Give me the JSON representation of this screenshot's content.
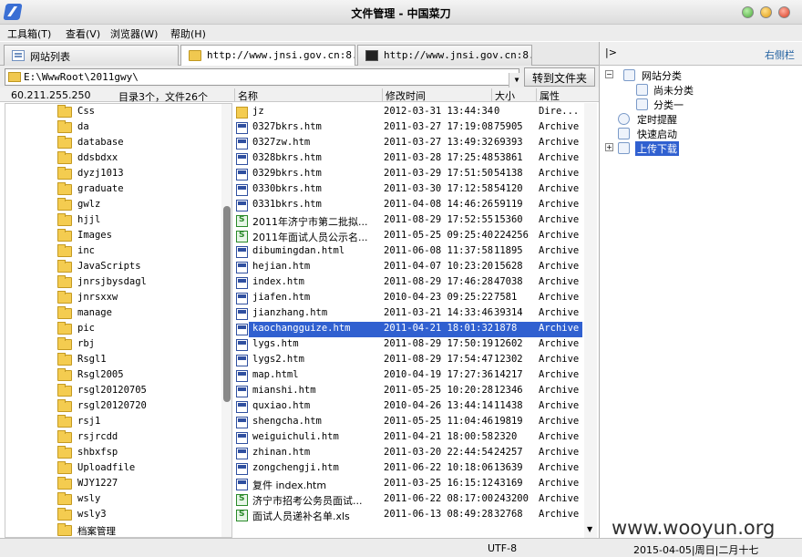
{
  "window": {
    "title": "文件管理 - 中国菜刀"
  },
  "menu": [
    "工具箱(T)",
    "查看(V)",
    "浏览器(W)",
    "帮助(H)"
  ],
  "tabs": [
    {
      "label": "网站列表",
      "icon": "page-icon"
    },
    {
      "label": "http://www.jnsi.gov.cn:8...",
      "icon": "folder-icon"
    },
    {
      "label": "http://www.jnsi.gov.cn:8...",
      "icon": "terminal-icon"
    }
  ],
  "sidebar": {
    "toggle": "|>",
    "title": "右侧栏",
    "items": [
      {
        "label": "网站分类",
        "expander": "−"
      },
      {
        "label": "尚未分类"
      },
      {
        "label": "分类一"
      },
      {
        "label": "定时提醒"
      },
      {
        "label": "快速启动"
      },
      {
        "label": "上传下载",
        "expander": "+"
      }
    ]
  },
  "path": {
    "value": "E:\\WwwRoot\\2011gwy\\",
    "goto_label": "转到文件夹"
  },
  "info": {
    "ip": "60.211.255.250",
    "count": "目录3个，文件26个"
  },
  "columns": {
    "name": "名称",
    "time": "修改时间",
    "size": "大小",
    "attr": "属性"
  },
  "tree": [
    "Css",
    "da",
    "database",
    "ddsbdxx",
    "dyzj1013",
    "graduate",
    "gwlz",
    "hjjl",
    "Images",
    "inc",
    "JavaScripts",
    "jnrsjbysdagl",
    "jnrsxxw",
    "manage",
    "pic",
    "rbj",
    "Rsgl1",
    "Rsgl2005",
    "rsgl20120705",
    "rsgl20120720",
    "rsj1",
    "rsjrcdd",
    "shbxfsp",
    "Uploadfile",
    "WJY1227",
    "wsly",
    "wsly3",
    "档案管理"
  ],
  "files": [
    {
      "name": "jz",
      "time": "2012-03-31 13:44:34",
      "size": "0",
      "attr": "Dire...",
      "type": "dir"
    },
    {
      "name": "0327bkrs.htm",
      "time": "2011-03-27 17:19:08",
      "size": "75905",
      "attr": "Archive",
      "type": "htm"
    },
    {
      "name": "0327zw.htm",
      "time": "2011-03-27 13:49:32",
      "size": "69393",
      "attr": "Archive",
      "type": "htm"
    },
    {
      "name": "0328bkrs.htm",
      "time": "2011-03-28 17:25:48",
      "size": "53861",
      "attr": "Archive",
      "type": "htm"
    },
    {
      "name": "0329bkrs.htm",
      "time": "2011-03-29 17:51:50",
      "size": "54138",
      "attr": "Archive",
      "type": "htm"
    },
    {
      "name": "0330bkrs.htm",
      "time": "2011-03-30 17:12:58",
      "size": "54120",
      "attr": "Archive",
      "type": "htm"
    },
    {
      "name": "0331bkrs.htm",
      "time": "2011-04-08 14:46:26",
      "size": "59119",
      "attr": "Archive",
      "type": "htm"
    },
    {
      "name": "2011年济宁市第二批拟...",
      "time": "2011-08-29 17:52:55",
      "size": "15360",
      "attr": "Archive",
      "type": "xls"
    },
    {
      "name": "2011年面试人员公示名...",
      "time": "2011-05-25 09:25:40",
      "size": "224256",
      "attr": "Archive",
      "type": "xls"
    },
    {
      "name": "dibumingdan.html",
      "time": "2011-06-08 11:37:58",
      "size": "11895",
      "attr": "Archive",
      "type": "htm"
    },
    {
      "name": "hejian.htm",
      "time": "2011-04-07 10:23:20",
      "size": "15628",
      "attr": "Archive",
      "type": "htm"
    },
    {
      "name": "index.htm",
      "time": "2011-08-29 17:46:28",
      "size": "47038",
      "attr": "Archive",
      "type": "htm"
    },
    {
      "name": "jiafen.htm",
      "time": "2010-04-23 09:25:22",
      "size": "7581",
      "attr": "Archive",
      "type": "htm"
    },
    {
      "name": "jianzhang.htm",
      "time": "2011-03-21 14:33:46",
      "size": "39314",
      "attr": "Archive",
      "type": "htm"
    },
    {
      "name": "kaochangguize.htm",
      "time": "2011-04-21 18:01:32",
      "size": "1878",
      "attr": "Archive",
      "type": "htm",
      "selected": true
    },
    {
      "name": "lygs.htm",
      "time": "2011-08-29 17:50:19",
      "size": "12602",
      "attr": "Archive",
      "type": "htm"
    },
    {
      "name": "lygs2.htm",
      "time": "2011-08-29 17:54:47",
      "size": "12302",
      "attr": "Archive",
      "type": "htm"
    },
    {
      "name": "map.html",
      "time": "2010-04-19 17:27:36",
      "size": "14217",
      "attr": "Archive",
      "type": "htm"
    },
    {
      "name": "mianshi.htm",
      "time": "2011-05-25 10:20:28",
      "size": "12346",
      "attr": "Archive",
      "type": "htm"
    },
    {
      "name": "quxiao.htm",
      "time": "2010-04-26 13:44:14",
      "size": "11438",
      "attr": "Archive",
      "type": "htm"
    },
    {
      "name": "shengcha.htm",
      "time": "2011-05-25 11:04:46",
      "size": "19819",
      "attr": "Archive",
      "type": "htm"
    },
    {
      "name": "weiguichuli.htm",
      "time": "2011-04-21 18:00:58",
      "size": "2320",
      "attr": "Archive",
      "type": "htm"
    },
    {
      "name": "zhinan.htm",
      "time": "2011-03-20 22:44:54",
      "size": "24257",
      "attr": "Archive",
      "type": "htm"
    },
    {
      "name": "zongchengji.htm",
      "time": "2011-06-22 10:18:06",
      "size": "13639",
      "attr": "Archive",
      "type": "htm"
    },
    {
      "name": "复件 index.htm",
      "time": "2011-03-25 16:15:12",
      "size": "43169",
      "attr": "Archive",
      "type": "htm"
    },
    {
      "name": "济宁市招考公务员面试...",
      "time": "2011-06-22 08:17:00",
      "size": "243200",
      "attr": "Archive",
      "type": "xls"
    },
    {
      "name": "面试人员递补名单.xls",
      "time": "2011-06-13 08:49:28",
      "size": "32768",
      "attr": "Archive",
      "type": "xls"
    }
  ],
  "status": {
    "encoding": "UTF-8",
    "datetime": "2015-04-05|周日|二月十七"
  },
  "watermark": "www.wooyun.org",
  "colors": {
    "selection": "#3060d0",
    "sidebar_title": "#2060a0"
  }
}
